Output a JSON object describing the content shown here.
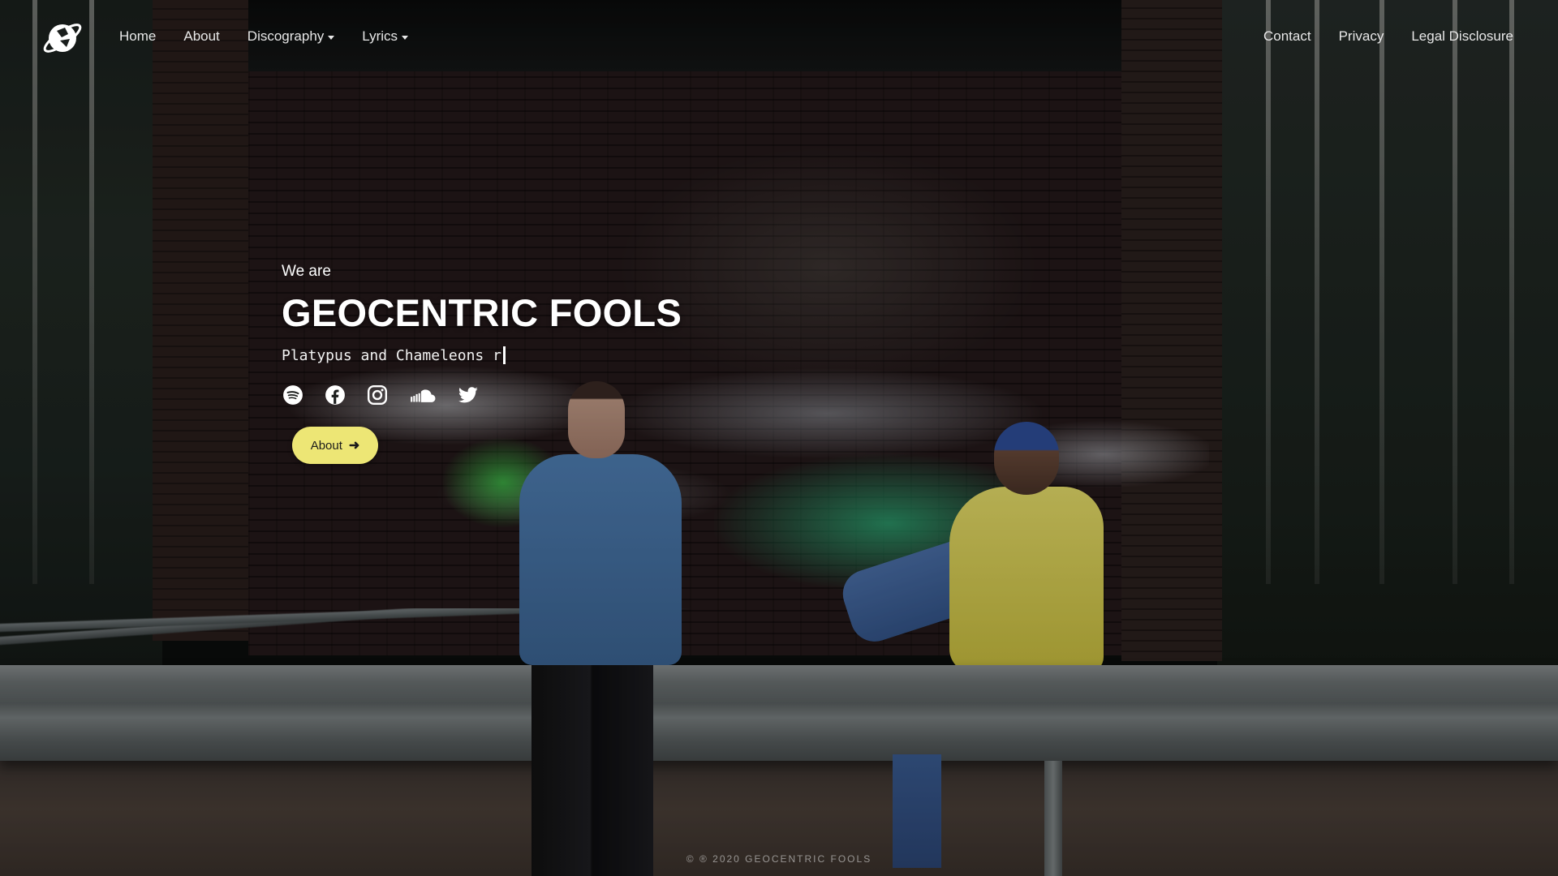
{
  "nav": {
    "left": [
      {
        "label": "Home",
        "dropdown": false
      },
      {
        "label": "About",
        "dropdown": false
      },
      {
        "label": "Discography",
        "dropdown": true
      },
      {
        "label": "Lyrics",
        "dropdown": true
      }
    ],
    "right": [
      {
        "label": "Contact"
      },
      {
        "label": "Privacy"
      },
      {
        "label": "Legal Disclosure"
      }
    ]
  },
  "hero": {
    "kicker": "We are",
    "title": "GEOCENTRIC FOOLS",
    "typed_text": "Platypus and Chameleons r",
    "socials": [
      "spotify-icon",
      "facebook-icon",
      "instagram-icon",
      "soundcloud-icon",
      "twitter-icon"
    ],
    "button_label": "About",
    "button_color": "#ede675"
  },
  "footer": {
    "text": "© ® 2020 GEOCENTRIC FOOLS"
  }
}
